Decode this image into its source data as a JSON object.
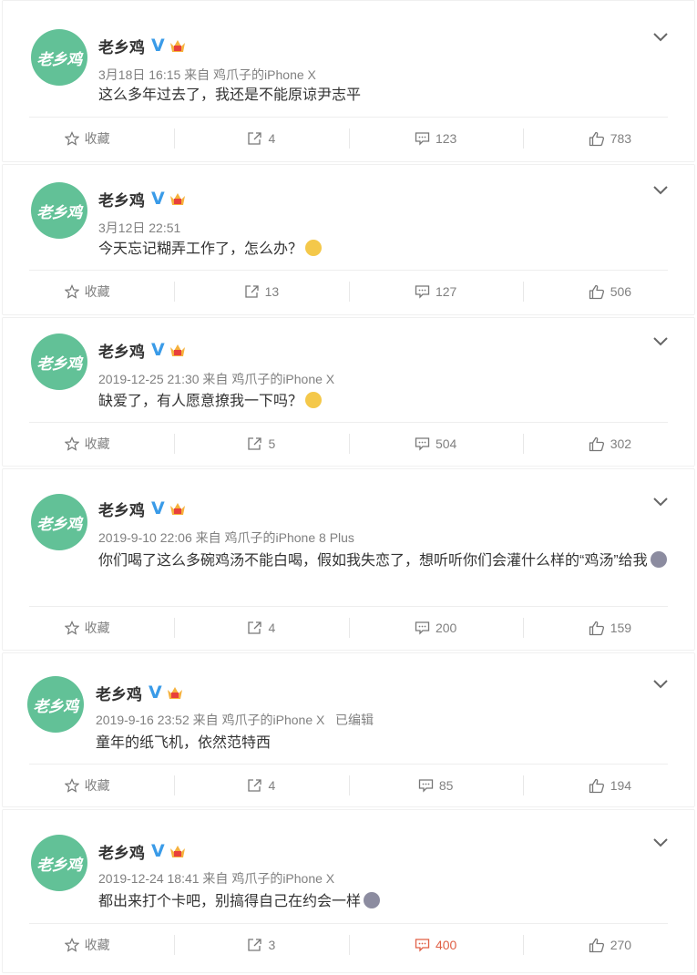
{
  "posts": [
    {
      "avatar_text": "老乡鸡",
      "name": "老乡鸡",
      "meta": "3月18日 16:15 来自 鸡爪子的iPhone X",
      "text": "这么多年过去了，我还是不能原谅尹志平",
      "emoji": "",
      "actions": {
        "collect": "收藏",
        "share": "4",
        "comment": "123",
        "like": "783"
      }
    },
    {
      "avatar_text": "老乡鸡",
      "name": "老乡鸡",
      "meta": "3月12日 22:51",
      "text": "今天忘记糊弄工作了，怎么办？",
      "emoji": "crying-face",
      "actions": {
        "collect": "收藏",
        "share": "13",
        "comment": "127",
        "like": "506"
      }
    },
    {
      "avatar_text": "老乡鸡",
      "name": "老乡鸡",
      "meta": "2019-12-25 21:30 来自 鸡爪子的iPhone X",
      "text": "缺爱了，有人愿意撩我一下吗？",
      "emoji": "blushing-face",
      "actions": {
        "collect": "收藏",
        "share": "5",
        "comment": "504",
        "like": "302"
      }
    },
    {
      "avatar_text": "老乡鸡",
      "name": "老乡鸡",
      "meta": "2019-9-10 22:06 来自 鸡爪子的iPhone 8 Plus",
      "text": "你们喝了这么多碗鸡汤不能白喝，假如我失恋了，想听听你们会灌什么样的“鸡汤”给我",
      "emoji": "sad-face",
      "actions": {
        "collect": "收藏",
        "share": "4",
        "comment": "200",
        "like": "159"
      }
    },
    {
      "avatar_text": "老乡鸡",
      "name": "老乡鸡",
      "meta": "2019-9-16 23:52 来自 鸡爪子的iPhone X   已编辑",
      "text": "童年的纸飞机，依然范特西",
      "emoji": "",
      "actions": {
        "collect": "收藏",
        "share": "4",
        "comment": "85",
        "like": "194"
      }
    },
    {
      "avatar_text": "老乡鸡",
      "name": "老乡鸡",
      "meta": "2019-12-24 18:41 来自 鸡爪子的iPhone X",
      "text": "都出来打个卡吧，别搞得自己在约会一样",
      "emoji": "sad-face",
      "actions": {
        "collect": "收藏",
        "share": "3",
        "comment": "400",
        "like": "270"
      }
    }
  ],
  "colors": {
    "avatar": "#62c197",
    "verified": "#3a9be8",
    "hot_comment": "#e05f45"
  },
  "icons": [
    "chevron-down-icon",
    "star-icon",
    "share-icon",
    "comment-icon",
    "thumbs-up-icon",
    "verified-icon",
    "crown-badge-icon"
  ]
}
